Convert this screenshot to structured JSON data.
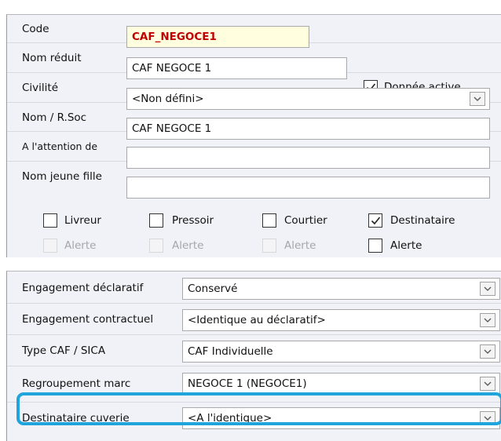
{
  "identity": {
    "code": {
      "label": "Code",
      "value": "CAF_NEGOCE1"
    },
    "nom_reduit": {
      "label": "Nom réduit",
      "value": "CAF NEGOCE 1"
    },
    "donnee_active": {
      "label": "Donnée active",
      "checked": true
    },
    "civilite": {
      "label": "Civilité",
      "value": "<Non défini>"
    },
    "nom_rsoc": {
      "label": "Nom / R.Soc",
      "value": "CAF NEGOCE 1"
    },
    "attention": {
      "label": "A l'attention de",
      "value": ""
    },
    "nom_jeune_fille": {
      "label": "Nom jeune fille",
      "value": ""
    }
  },
  "roles": [
    {
      "label": "Livreur",
      "checked": false,
      "alerte": {
        "label": "Alerte",
        "checked": false,
        "enabled": false
      }
    },
    {
      "label": "Pressoir",
      "checked": false,
      "alerte": {
        "label": "Alerte",
        "checked": false,
        "enabled": false
      }
    },
    {
      "label": "Courtier",
      "checked": false,
      "alerte": {
        "label": "Alerte",
        "checked": false,
        "enabled": false
      }
    },
    {
      "label": "Destinataire",
      "checked": true,
      "alerte": {
        "label": "Alerte",
        "checked": false,
        "enabled": true
      }
    }
  ],
  "engagements": [
    {
      "label": "Engagement déclaratif",
      "value": "Conservé"
    },
    {
      "label": "Engagement contractuel",
      "value": "<Identique au déclaratif>"
    },
    {
      "label": "Type CAF / SICA",
      "value": "CAF Individuelle"
    },
    {
      "label": "Regroupement marc",
      "value": "NEGOCE 1  (NEGOCE1)"
    },
    {
      "label": "Destinataire cuverie",
      "value": "<A l'identique>"
    }
  ],
  "colors": {
    "highlight": "#1fa4dc",
    "code_text": "#c00000",
    "code_bg": "#ffffe0",
    "panel_bg": "#f1f2f8"
  },
  "icons": {
    "dropdown": "chevron-down-icon",
    "check": "check-icon"
  }
}
